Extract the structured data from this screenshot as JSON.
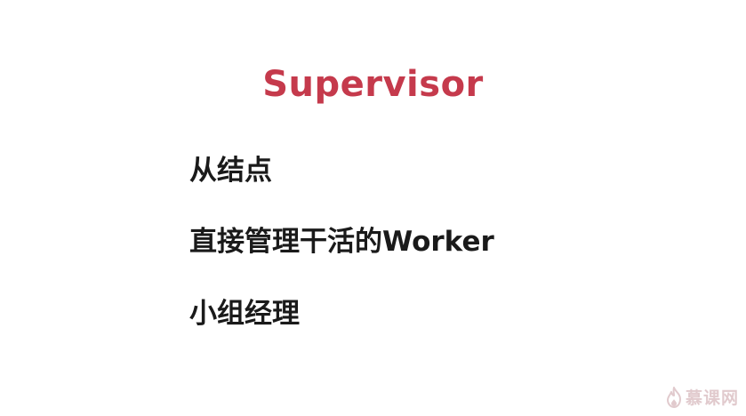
{
  "slide": {
    "title": "Supervisor",
    "lines": [
      "从结点",
      "直接管理干活的Worker",
      "小组经理"
    ]
  },
  "watermark": {
    "text": "慕课网",
    "icon": "flame-icon",
    "color": "#c9a0a6"
  },
  "colors": {
    "title": "#c53a4c",
    "text": "#1a1a1a",
    "background": "#ffffff"
  }
}
